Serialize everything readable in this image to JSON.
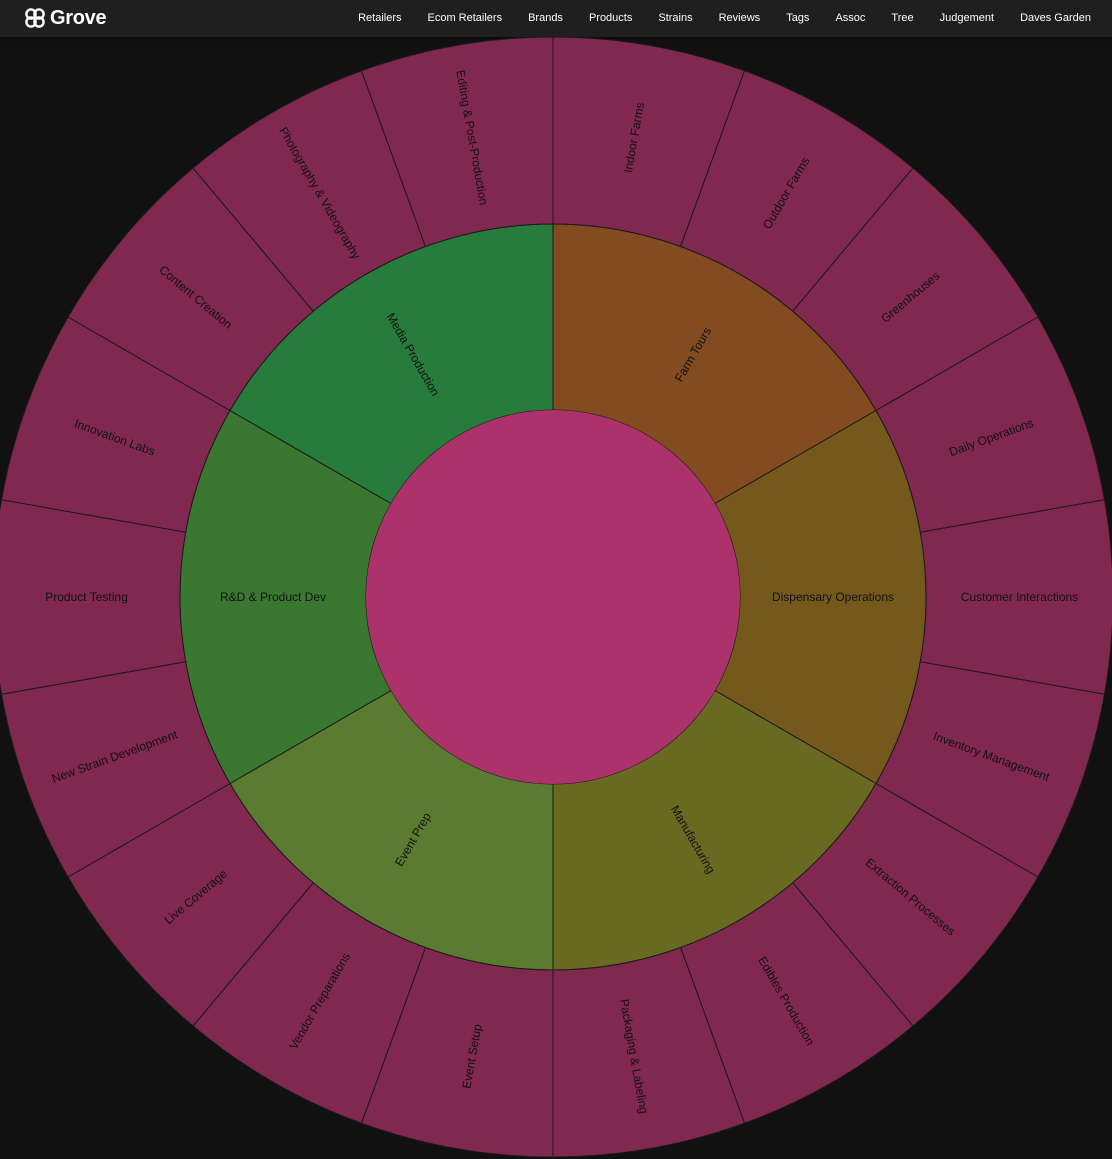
{
  "header": {
    "brand_name": "Grove",
    "nav": [
      "Retailers",
      "Ecom Retailers",
      "Brands",
      "Products",
      "Strains",
      "Reviews",
      "Tags",
      "Assoc",
      "Tree",
      "Judgement",
      "Daves Garden"
    ]
  },
  "colors": {
    "background": "#111111",
    "header": "#1f1f1f",
    "center": "#ab326a",
    "outer_ring": "#812850",
    "divider": "#1a1a1a"
  },
  "sunburst": {
    "categories": [
      {
        "label": "Farm Tours",
        "color": "#834b20",
        "children": [
          "Indoor Farms",
          "Outdoor Farms",
          "Greenhouses"
        ]
      },
      {
        "label": "Dispensary Operations",
        "color": "#75591c",
        "children": [
          "Daily Operations",
          "Customer Interactions",
          "Inventory Management"
        ]
      },
      {
        "label": "Manufacturing",
        "color": "#6a6921",
        "children": [
          "Extraction Processes",
          "Edibles Production",
          "Packaging & Labeling"
        ]
      },
      {
        "label": "Event Prep",
        "color": "#5b7b31",
        "children": [
          "Event Setup",
          "Vendor Preparations",
          "Live Coverage"
        ]
      },
      {
        "label": "R&D & Product Dev",
        "color": "#3a7831",
        "children": [
          "New Strain Development",
          "Product Testing",
          "Innovation Labs"
        ]
      },
      {
        "label": "Media Production",
        "color": "#287c3b",
        "children": [
          "Content Creation",
          "Photography & Videography",
          "Editing & Post-Production"
        ]
      }
    ]
  }
}
